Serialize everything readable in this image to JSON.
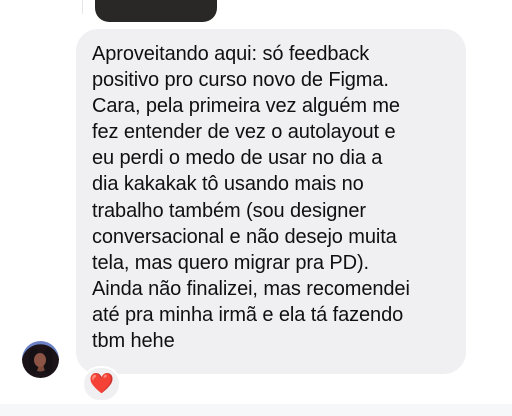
{
  "conversation": {
    "message": {
      "text": "Aproveitando aqui: só feedback\npositivo pro curso novo de Figma.\nCara, pela primeira vez alguém me\nfez entender de vez o autolayout e\neu perdi o medo de usar no dia a\ndia kakakak tô usando mais no\ntrabalho também (sou designer\nconversacional e não desejo muita\ntela, mas quero migrar pra PD).\nAinda não finalizei, mas recomendei\naté pra minha irmã e ela tá fazendo\ntbm hehe"
    },
    "reaction": {
      "emoji": "❤️",
      "color": "#e0383e"
    },
    "avatar": {
      "icon": "profile-photo-icon"
    }
  },
  "colors": {
    "bubble_background": "#f0f0f3",
    "text": "#101010",
    "page_background": "#ffffff"
  }
}
